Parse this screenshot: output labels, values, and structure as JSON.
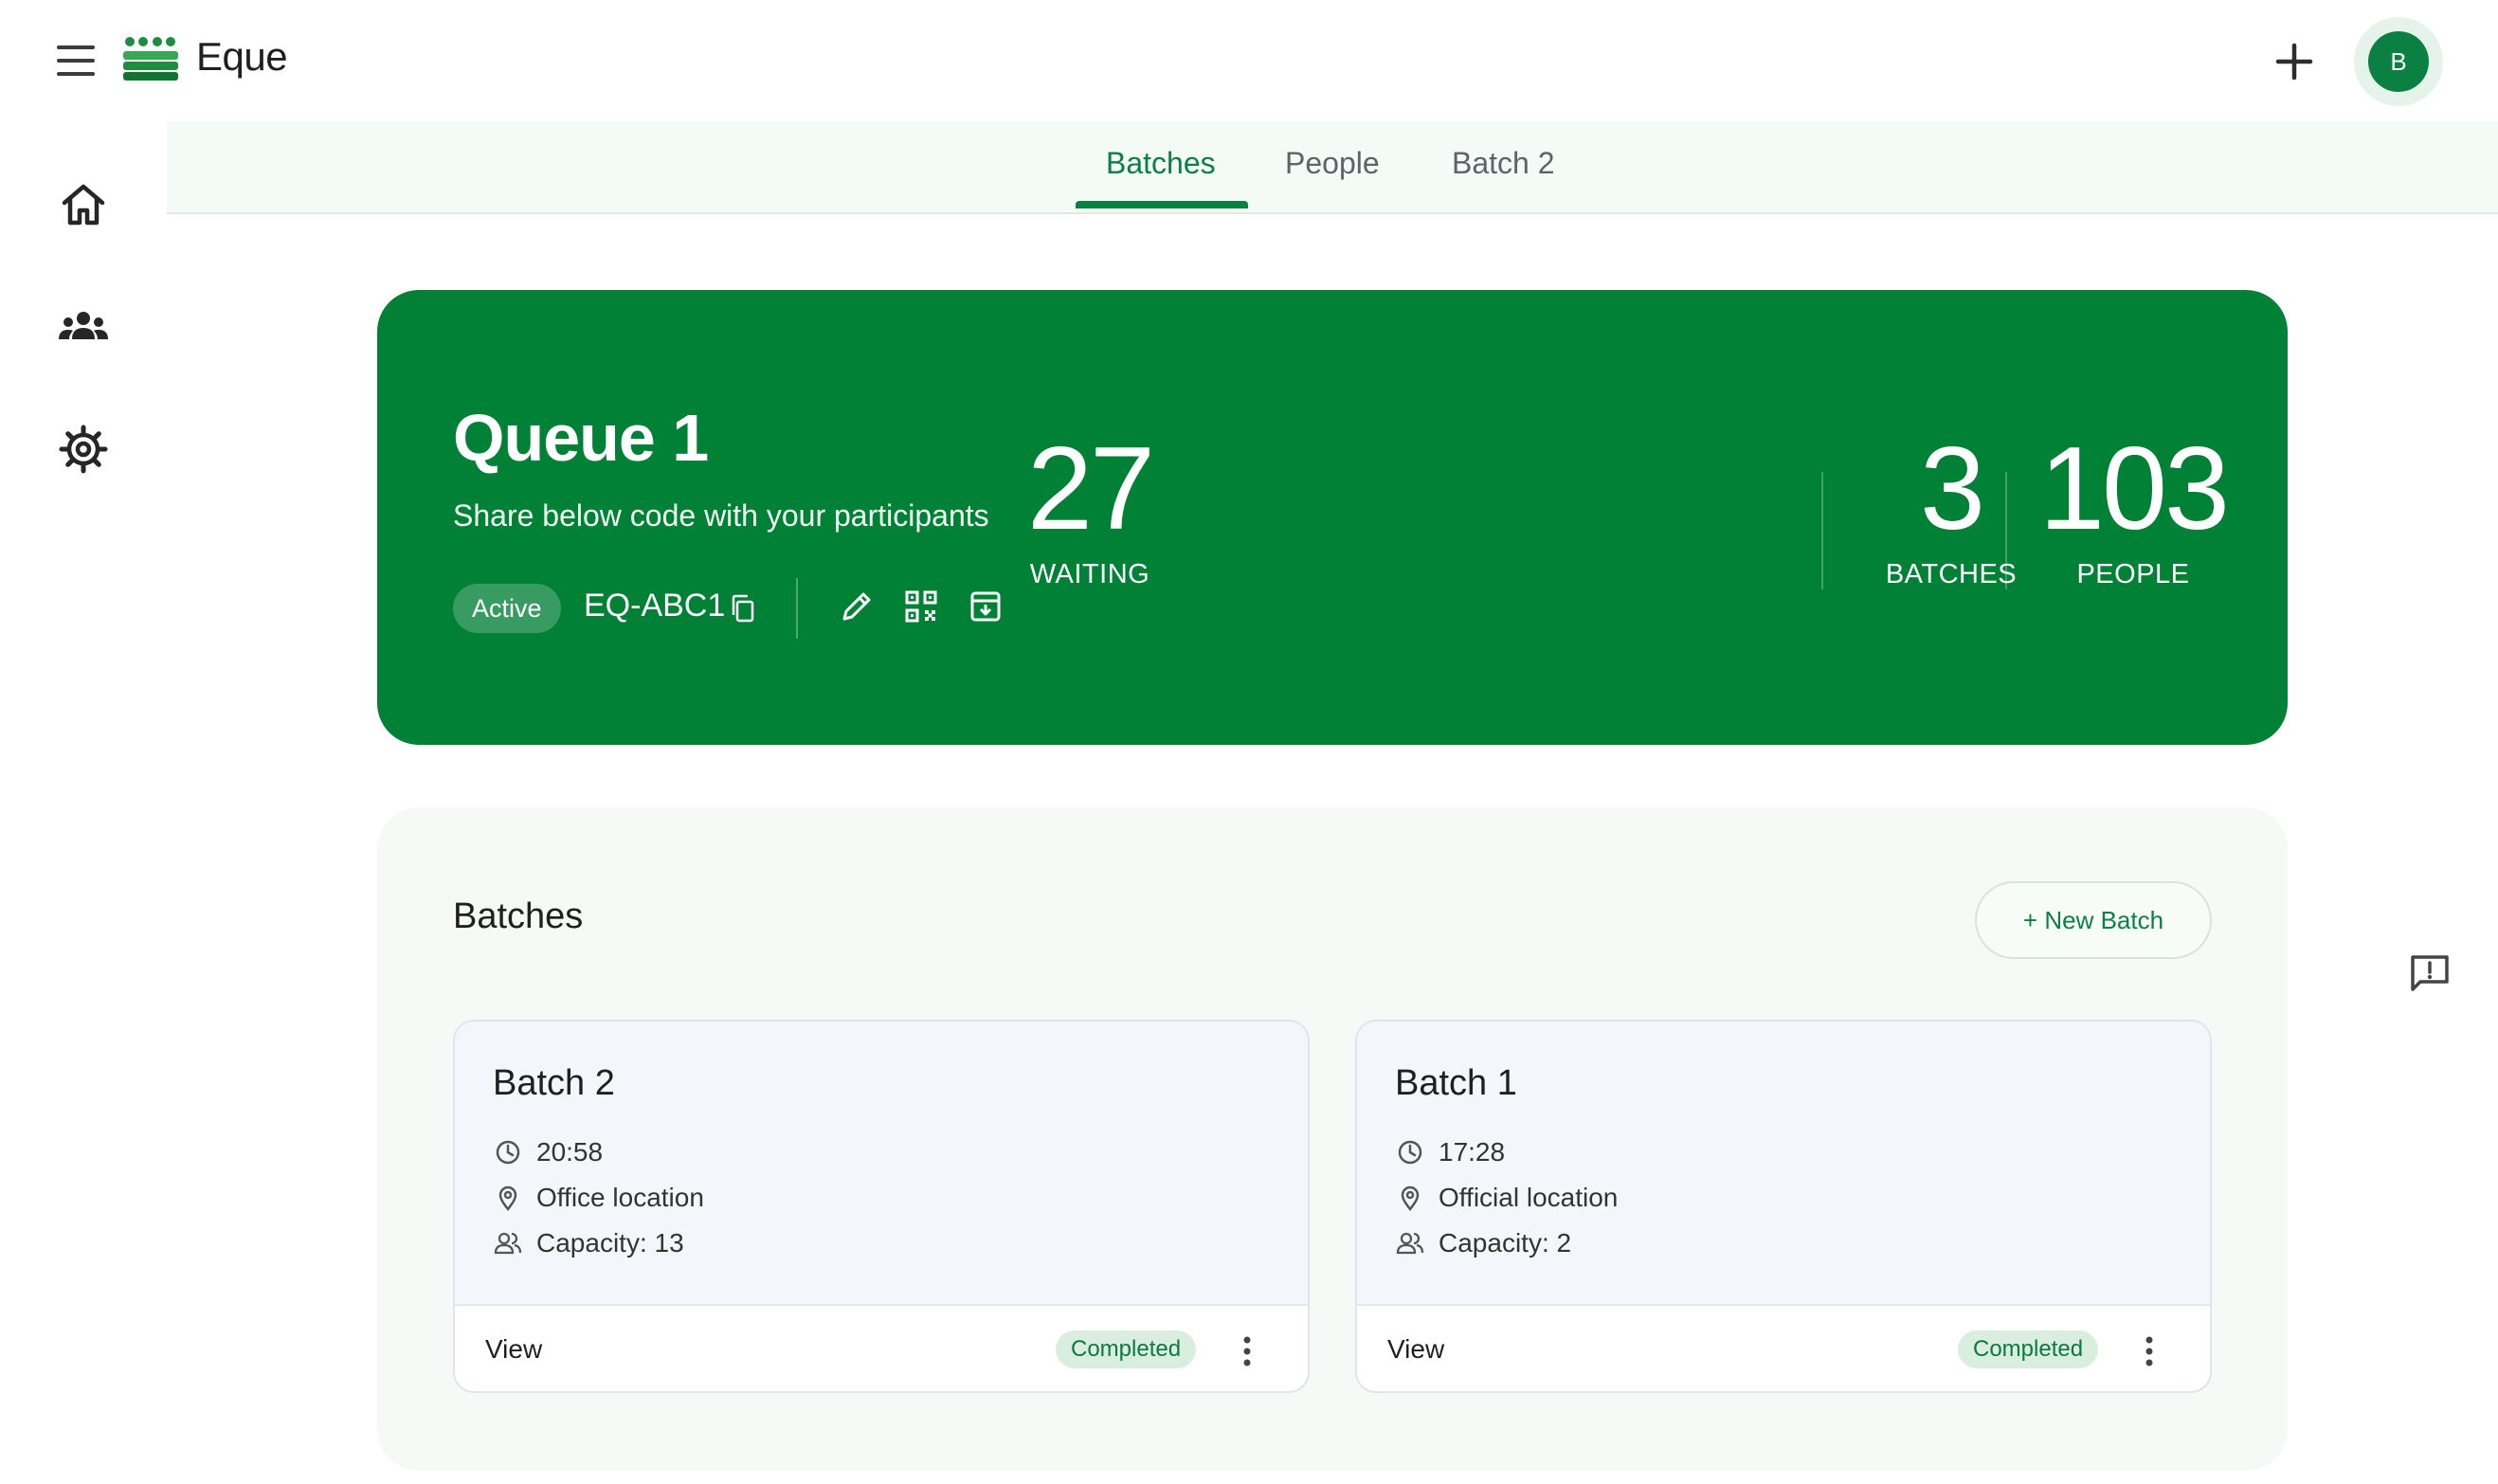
{
  "app": {
    "title": "Eque"
  },
  "user": {
    "avatar_initial": "B"
  },
  "icons": {
    "menu": "menu-icon",
    "logo": "eque-logo-icon",
    "add": "plus-icon",
    "home": "home-icon",
    "people": "group-icon",
    "settings": "gear-icon",
    "copy": "copy-icon",
    "edit": "pencil-icon",
    "qr": "qr-code-icon",
    "archive": "archive-icon",
    "time": "clock-icon",
    "location": "location-pin-icon",
    "capacity": "people-outline-icon",
    "more": "more-vert-icon",
    "feedback": "feedback-icon"
  },
  "colors": {
    "brand": "#0b8043",
    "hero_bg": "#008136",
    "chip_bg": "#d9eedf"
  },
  "tabs": [
    {
      "label": "Batches",
      "active": true
    },
    {
      "label": "People",
      "active": false
    },
    {
      "label": "Batch 2",
      "active": false
    }
  ],
  "queue": {
    "title": "Queue 1",
    "subtitle": "Share below code with your participants",
    "status": "Active",
    "code": "EQ-ABC1",
    "stats": [
      {
        "value": "27",
        "label": "WAITING"
      },
      {
        "value": "3",
        "label": "BATCHES"
      },
      {
        "value": "103",
        "label": "PEOPLE"
      }
    ]
  },
  "batches_section": {
    "title": "Batches",
    "new_button": "+ New Batch",
    "cards": [
      {
        "name": "Batch 2",
        "time": "20:58",
        "location": "Office location",
        "capacity": "Capacity: 13",
        "view_label": "View",
        "status": "Completed"
      },
      {
        "name": "Batch 1",
        "time": "17:28",
        "location": "Official location",
        "capacity": "Capacity: 2",
        "view_label": "View",
        "status": "Completed"
      }
    ]
  }
}
